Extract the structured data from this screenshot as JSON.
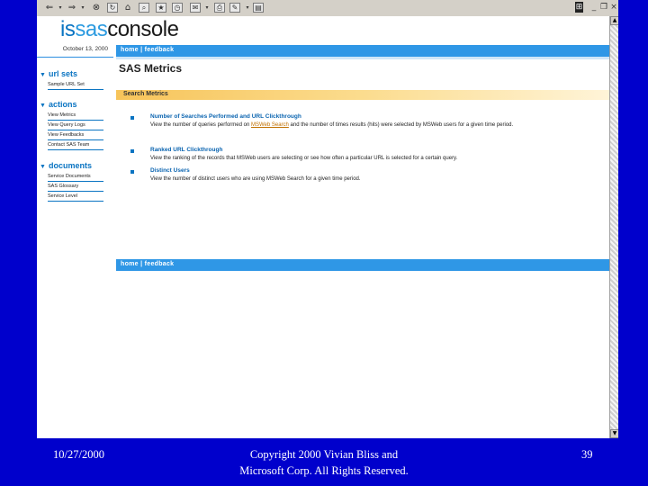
{
  "logo": {
    "part1": "is",
    "part2": "sas",
    "part3": "console"
  },
  "date": "October 13, 2000",
  "nav": {
    "top": "home | feedback",
    "bottom": "home | feedback"
  },
  "sidebar": {
    "sections": [
      {
        "title": "url sets",
        "items": [
          "Sample URL Set"
        ]
      },
      {
        "title": "actions",
        "items": [
          "View Metrics",
          "View Query Logs",
          "View Feedbacks",
          "Contact SAS Team"
        ]
      },
      {
        "title": "documents",
        "items": [
          "Service Documents",
          "SAS Glossary",
          "Service Level"
        ]
      }
    ]
  },
  "main": {
    "title": "SAS Metrics",
    "section_header": "Search Metrics",
    "metrics": [
      {
        "link": "Number of Searches Performed and URL Clickthrough",
        "desc_pre": "View the number of queries performed on ",
        "desc_link": "MSWeb Search",
        "desc_post": " and the number of times results (hits) were selected by MSWeb users for a given time period."
      },
      {
        "link": "Ranked URL Clickthrough",
        "desc_pre": "View the ranking of the records that MSWeb users are selecting or see how often a particular URL is selected for a certain query.",
        "desc_link": "",
        "desc_post": ""
      },
      {
        "link": "Distinct Users",
        "desc_pre": "View the number of distinct users who are using MSWeb Search for a given time period.",
        "desc_link": "",
        "desc_post": ""
      }
    ]
  },
  "footer": {
    "date": "10/27/2000",
    "copyright_line1": "Copyright 2000 Vivian Bliss and",
    "copyright_line2": "Microsoft Corp. All Rights Reserved.",
    "slide_number": "39"
  },
  "toolbar_icons": [
    "back-icon",
    "forward-icon",
    "stop-icon",
    "refresh-icon",
    "home-icon",
    "search-icon",
    "favorites-icon",
    "history-icon",
    "mail-icon",
    "print-icon",
    "edit-icon"
  ],
  "colors": {
    "slide_bg": "#0000cc",
    "brand_blue": "#0a74c2",
    "nav_blue": "#2f97e6",
    "section_gold": "#f7c45a"
  }
}
